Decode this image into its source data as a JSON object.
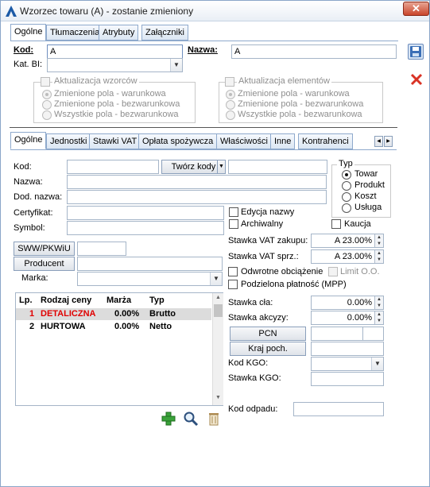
{
  "window": {
    "title": "Wzorzec towaru (A) - zostanie zmieniony",
    "close_glyph": "✕"
  },
  "top_tabs": [
    "Ogólne",
    "Tłumaczenia",
    "Atrybuty",
    "Załączniki"
  ],
  "header": {
    "kod_label": "Kod:",
    "kod_value": "A",
    "nazwa_label": "Nazwa:",
    "nazwa_value": "A",
    "katbi_label": "Kat. BI:",
    "katbi_value": ""
  },
  "aktualizacja_wzorcow": {
    "title": "Aktualizacja wzorców",
    "options": [
      "Zmienione pola - warunkowa",
      "Zmienione pola - bezwarunkowa",
      "Wszystkie pola - bezwarunkowa"
    ]
  },
  "aktualizacja_elementow": {
    "title": "Aktualizacja elementów",
    "options": [
      "Zmienione pola - warunkowa",
      "Zmienione pola - bezwarunkowa",
      "Wszystkie pola - bezwarunkowa"
    ]
  },
  "inner_tabs": [
    "Ogólne",
    "Jednostki",
    "Stawki VAT",
    "Opłata spożywcza",
    "Właściwości",
    "Inne",
    "Kontrahenci"
  ],
  "general": {
    "kod_label": "Kod:",
    "tworz_kody": "Twórz kody",
    "nazwa_label": "Nazwa:",
    "dod_nazwa_label": "Dod. nazwa:",
    "certyfikat_label": "Certyfikat:",
    "symbol_label": "Symbol:",
    "edycja_nazwy": "Edycja nazwy",
    "archiwalny": "Archiwalny",
    "kaucja": "Kaucja",
    "sww_button": "SWW/PKWiU",
    "producent_button": "Producent",
    "marka_label": "Marka:"
  },
  "typ": {
    "title": "Typ",
    "options": [
      "Towar",
      "Produkt",
      "Koszt",
      "Usługa"
    ],
    "selected": "Towar"
  },
  "vat": {
    "zakupu_label": "Stawka VAT zakupu:",
    "zakupu_value": "A 23.00%",
    "sprz_label": "Stawka VAT sprz.:",
    "sprz_value": "A 23.00%",
    "odwrotne": "Odwrotne obciążenie",
    "limit": "Limit O.O.",
    "podzielona": "Podzielona płatność (MPP)",
    "cla_label": "Stawka cła:",
    "cla_value": "0.00%",
    "akcyzy_label": "Stawka akcyzy:",
    "akcyzy_value": "0.00%",
    "pcn_button": "PCN",
    "kraj_button": "Kraj poch.",
    "kod_kgo_label": "Kod KGO:",
    "stawka_kgo_label": "Stawka KGO:",
    "kod_odpadu_label": "Kod odpadu:"
  },
  "price_table": {
    "columns": [
      "Lp.",
      "Rodzaj ceny",
      "Marża",
      "Typ"
    ],
    "rows": [
      {
        "lp": "1",
        "name": "DETALICZNA",
        "marza": "0.00%",
        "typ": "Brutto",
        "color": "#e00000"
      },
      {
        "lp": "2",
        "name": "HURTOWA",
        "marza": "0.00%",
        "typ": "Netto",
        "color": "#000000"
      }
    ]
  },
  "colors": {
    "accent": "#1c5aa6",
    "close": "#c9452b",
    "add_green": "#3aa23a"
  }
}
